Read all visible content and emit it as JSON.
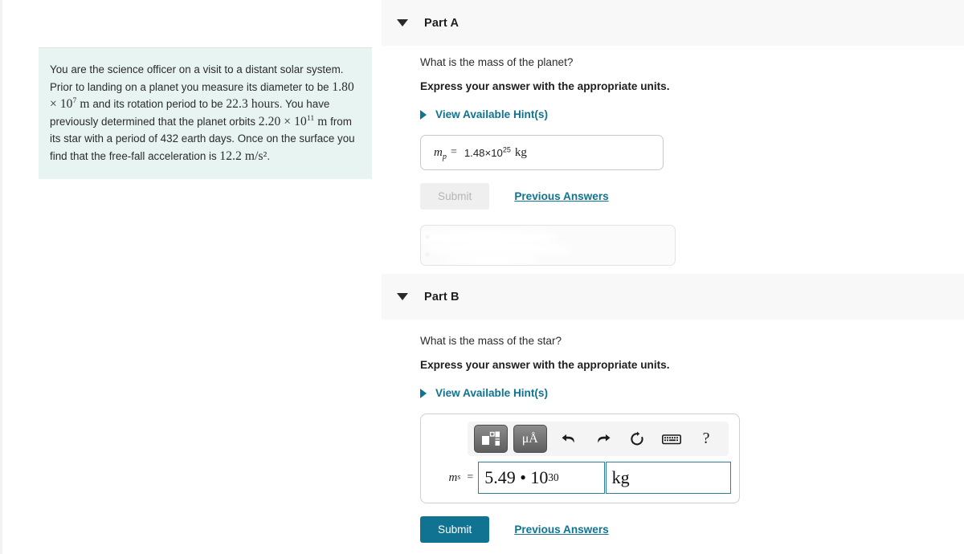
{
  "question": {
    "segments": [
      {
        "t": "text",
        "v": "You are the science officer on a visit to a distant solar system. Prior to landing on a planet you measure its diameter to be "
      },
      {
        "t": "math",
        "v": "1.80 × 10^7 m"
      },
      {
        "t": "text",
        "v": " and its rotation period to be "
      },
      {
        "t": "math",
        "v": "22.3 hours"
      },
      {
        "t": "text",
        "v": ". You have previously determined that the planet orbits "
      },
      {
        "t": "math",
        "v": "2.20 × 10^11 m"
      },
      {
        "t": "text",
        "v": " from its star with a period of 432 earth days. Once on the surface you find that the free-fall acceleration is "
      },
      {
        "t": "math",
        "v": "12.2 m/s^2"
      },
      {
        "t": "text",
        "v": "."
      }
    ],
    "full_text": "You are the science officer on a visit to a distant solar system. Prior to landing on a planet you measure its diameter to be 1.80 × 10⁷ m and its rotation period to be 22.3 hours. You have previously determined that the planet orbits 2.20 × 10¹¹ m from its star with a period of 432 earth days. Once on the surface you find that the free-fall acceleration is 12.2 m/s².",
    "diameter_mantissa": "1.80",
    "diameter_exponent": "7",
    "diameter_unit": "m",
    "rotation_period": "22.3",
    "rotation_unit": "hours",
    "orbit_radius_mantissa": "2.20",
    "orbit_radius_exponent": "11",
    "orbit_radius_unit": "m",
    "orbital_period_days": "432",
    "gravity_value": "12.2",
    "gravity_unit": "m/s²"
  },
  "part_a": {
    "title": "Part A",
    "caret_icon": "caret-down-icon",
    "prompt": "What is the mass of the planet?",
    "instruction": "Express your answer with the appropriate units.",
    "hint_label": "View Available Hint(s)",
    "hint_caret_icon": "caret-right-icon",
    "answer": {
      "symbol": "m",
      "subscript": "p",
      "equals": "=",
      "mantissa": "1.48×10",
      "exponent": "25",
      "unit": "kg",
      "full": "mp = 1.48×10^25 kg"
    },
    "submit_label": "Submit",
    "submit_state": "disabled",
    "previous_answers_label": "Previous Answers",
    "feedback_box_state": "obscured"
  },
  "part_b": {
    "title": "Part B",
    "caret_icon": "caret-down-icon",
    "prompt": "What is the mass of the star?",
    "instruction": "Express your answer with the appropriate units.",
    "hint_label": "View Available Hint(s)",
    "hint_caret_icon": "caret-right-icon",
    "toolbar": {
      "template_button": "template-icon",
      "units_button": "μÅ",
      "undo_icon": "undo-arrow-icon",
      "redo_icon": "redo-arrow-icon",
      "reset_icon": "reset-circular-arrow-icon",
      "keyboard_icon": "keyboard-icon",
      "help_label": "?"
    },
    "answer": {
      "symbol": "m",
      "subscript": "s",
      "equals": "=",
      "value_mantissa": "5.49 • 10",
      "value_exponent": "30",
      "unit": "kg",
      "full": "ms = 5.49 • 10^30 kg"
    },
    "submit_label": "Submit",
    "submit_state": "active",
    "previous_answers_label": "Previous Answers"
  },
  "colors": {
    "accent_teal": "#0f7391",
    "question_bg": "#e7f4f2",
    "header_bg": "#f8f8f8",
    "field_border": "#2e7e9e",
    "divider": "#ccd7e4"
  }
}
